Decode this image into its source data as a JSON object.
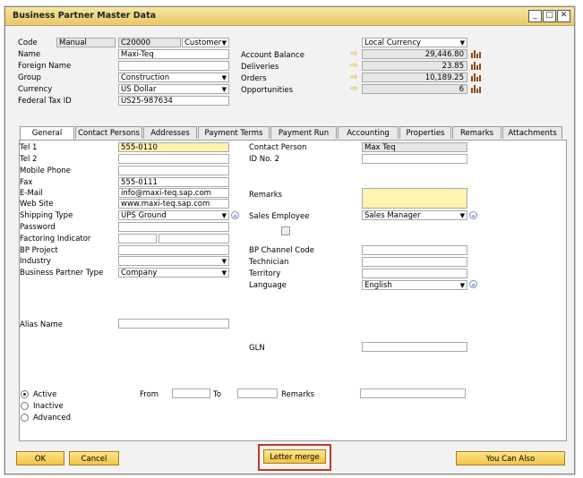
{
  "window": {
    "title": "Business Partner Master Data"
  },
  "header": {
    "code_label": "Code",
    "code_type": "Manual",
    "code_value": "C20000",
    "bp_type": "Customer",
    "name_label": "Name",
    "name_value": "Maxi-Teq",
    "foreign_name_label": "Foreign Name",
    "group_label": "Group",
    "group_value": "Construction",
    "currency_label": "Currency",
    "currency_value": "US Dollar",
    "fed_tax_label": "Federal Tax ID",
    "fed_tax_value": "US25-987634",
    "currency_mode": "Local Currency",
    "account_balance_label": "Account Balance",
    "account_balance_value": "29,446.80",
    "deliveries_label": "Deliveries",
    "deliveries_value": "23.85",
    "orders_label": "Orders",
    "orders_value": "10,189.25",
    "opportunities_label": "Opportunities",
    "opportunities_value": "6"
  },
  "tabs": [
    "General",
    "Contact Persons",
    "Addresses",
    "Payment Terms",
    "Payment Run",
    "Accounting",
    "Properties",
    "Remarks",
    "Attachments"
  ],
  "general": {
    "tel1_label": "Tel 1",
    "tel1_value": "555-0110",
    "tel2_label": "Tel 2",
    "mobile_label": "Mobile Phone",
    "fax_label": "Fax",
    "fax_value": "555-0111",
    "email_label": "E-Mail",
    "email_value": "info@maxi-teq.sap.com",
    "website_label": "Web Site",
    "website_value": "www.maxi-teq.sap.com",
    "shipping_label": "Shipping Type",
    "shipping_value": "UPS Ground",
    "password_label": "Password",
    "factoring_label": "Factoring Indicator",
    "bp_project_label": "BP Project",
    "industry_label": "Industry",
    "bp_type_label": "Business Partner Type",
    "bp_type_value": "Company",
    "alias_label": "Alias Name",
    "contact_label": "Contact Person",
    "contact_value": "Max Teq",
    "idno2_label": "ID No. 2",
    "remarks_label": "Remarks",
    "sales_emp_label": "Sales Employee",
    "sales_emp_value": "Sales Manager",
    "channel_label": "BP Channel Code",
    "technician_label": "Technician",
    "territory_label": "Territory",
    "language_label": "Language",
    "language_value": "English",
    "gln_label": "GLN",
    "active_label": "Active",
    "inactive_label": "Inactive",
    "advanced_label": "Advanced",
    "from_label": "From",
    "to_label": "To",
    "remarks2_label": "Remarks"
  },
  "footer": {
    "ok_label": "OK",
    "cancel_label": "Cancel",
    "letter_merge_label": "Letter merge",
    "you_can_also_label": "You Can Also"
  },
  "colors": {
    "highlight_box": "#c0392b",
    "button_fill": "#f2c443",
    "title_bar": "#e8c868"
  }
}
